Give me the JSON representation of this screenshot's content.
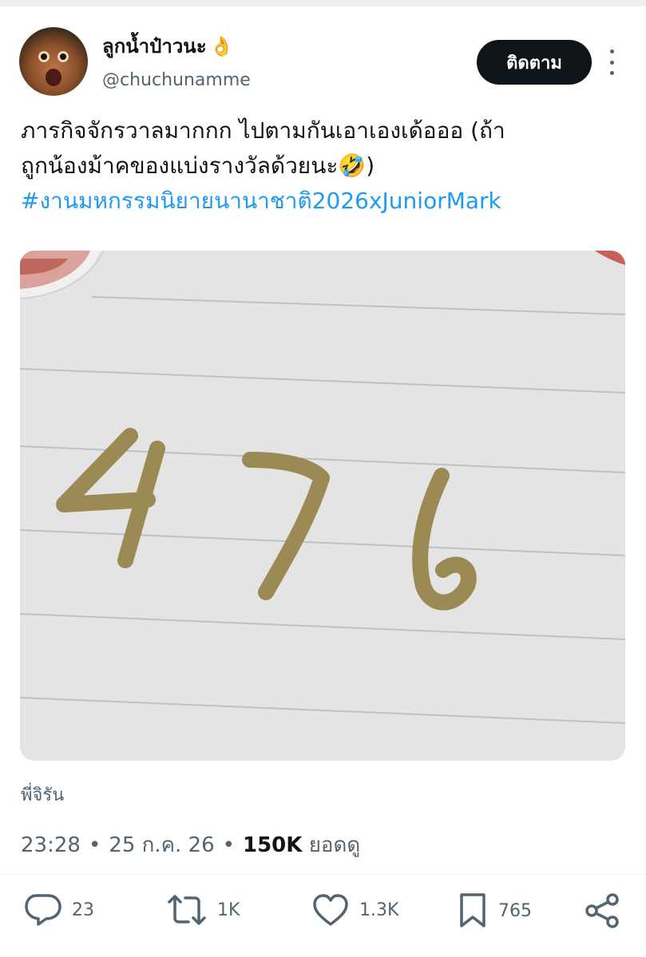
{
  "author": {
    "display_name": "ลูกน้ำป๋าวนะ",
    "name_emoji": "👌",
    "handle": "@chuchunamme",
    "avatar_icon": "dog-avatar"
  },
  "follow_label": "ติดตาม",
  "tweet": {
    "line1": "ภารกิจจักรวาลมากกก ไปตามกันเอาเองเด้อออ (ถ้า",
    "line2": "ถูกน้องม้าคของแบ่งรางวัลด้วยนะ🤣)",
    "hashtag": "#งานมหกรรมนิยายนานาชาติ2026xJuniorMark"
  },
  "media": {
    "digits": [
      "4",
      "7",
      "6"
    ],
    "ink_color": "#9c8a55",
    "paper_color": "#e3e4e3",
    "line_color": "#b7c0c6"
  },
  "picture_credit": "พี่จิรัน",
  "meta": {
    "time": "23:28",
    "sep1": "•",
    "date": "25 ก.ค. 26",
    "sep2": "•",
    "views": "150K",
    "views_label": "ยอดดู"
  },
  "actions": {
    "replies": "23",
    "reposts": "1K",
    "likes": "1.3K",
    "bookmarks": "765"
  },
  "colors": {
    "accent": "#1d9bf0",
    "text": "#0f1419",
    "secondary": "#536471"
  }
}
